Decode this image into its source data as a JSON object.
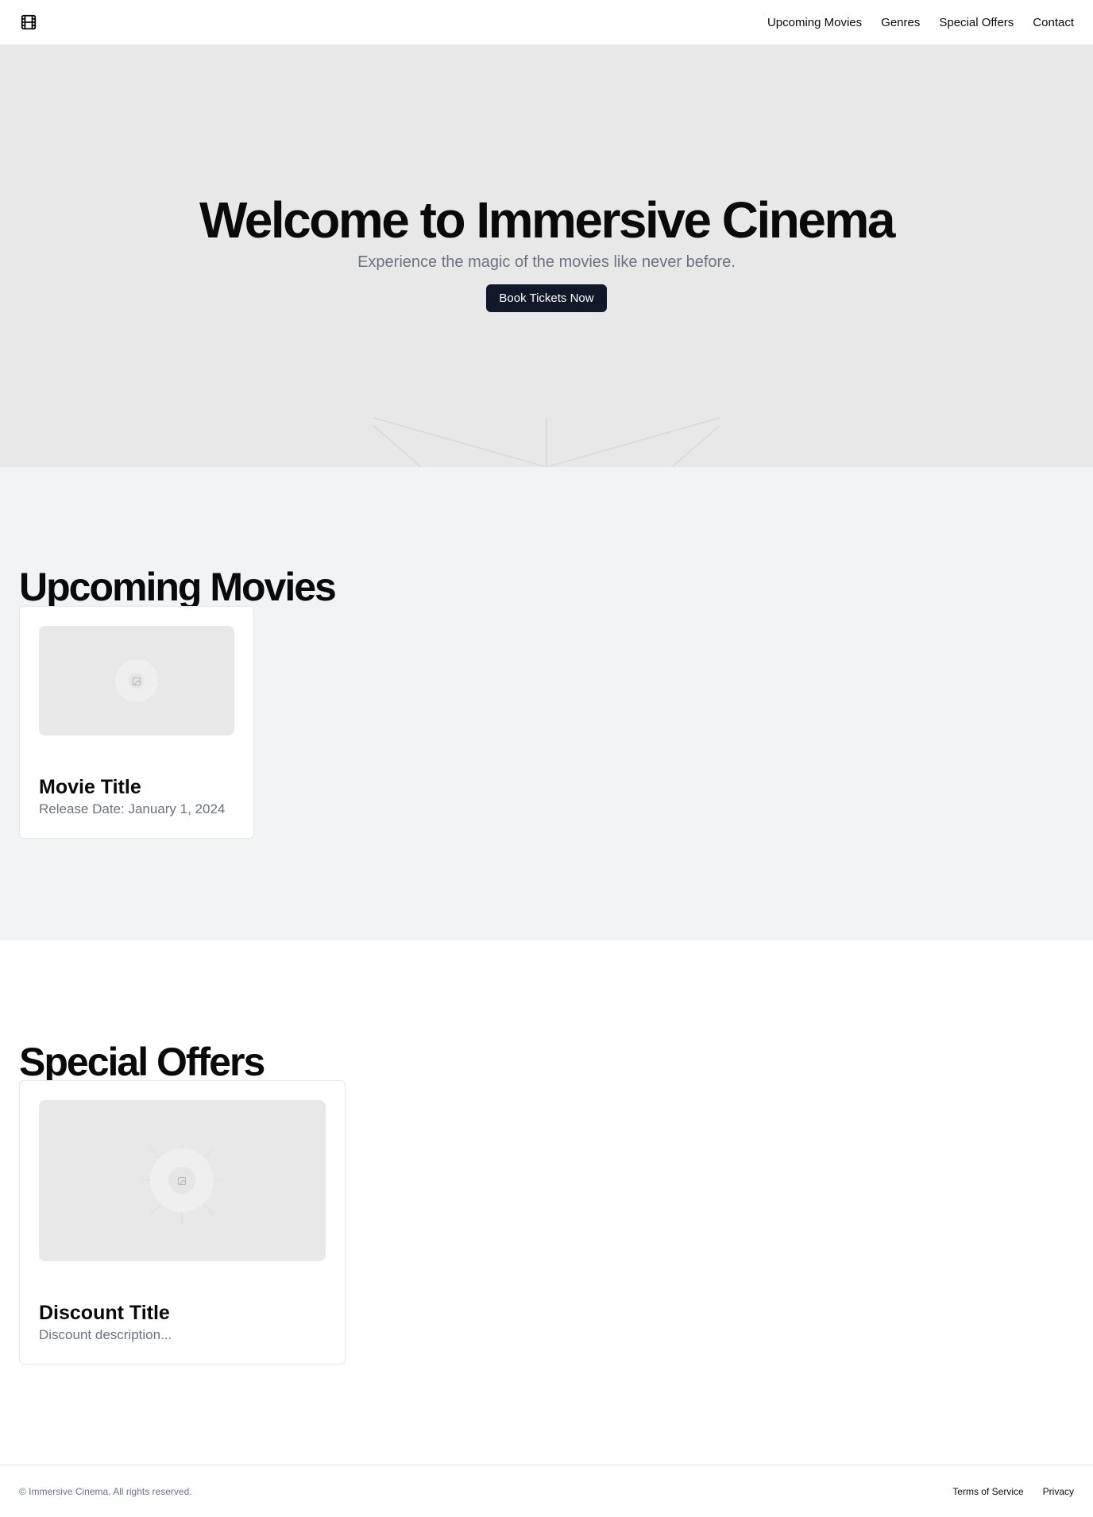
{
  "header": {
    "logo_icon": "film-icon",
    "nav": [
      {
        "label": "Upcoming Movies"
      },
      {
        "label": "Genres"
      },
      {
        "label": "Special Offers"
      },
      {
        "label": "Contact"
      }
    ]
  },
  "hero": {
    "title": "Welcome to Immersive Cinema",
    "subtitle": "Experience the magic of the movies like never before.",
    "cta_label": "Book Tickets Now"
  },
  "upcoming": {
    "heading": "Upcoming Movies",
    "card": {
      "image_icon": "image-placeholder-icon",
      "title": "Movie Title",
      "release": "Release Date: January 1, 2024"
    }
  },
  "offers": {
    "heading": "Special Offers",
    "card": {
      "image_icon": "image-placeholder-icon",
      "title": "Discount Title",
      "description": "Discount description..."
    }
  },
  "footer": {
    "copyright": "© Immersive Cinema. All rights reserved.",
    "links": [
      {
        "label": "Terms of Service"
      },
      {
        "label": "Privacy"
      }
    ]
  },
  "colors": {
    "hero_bg": "#e8e8e8",
    "section_alt_bg": "#f2f3f5",
    "button_bg": "#111827",
    "muted_text": "#6b7280"
  }
}
